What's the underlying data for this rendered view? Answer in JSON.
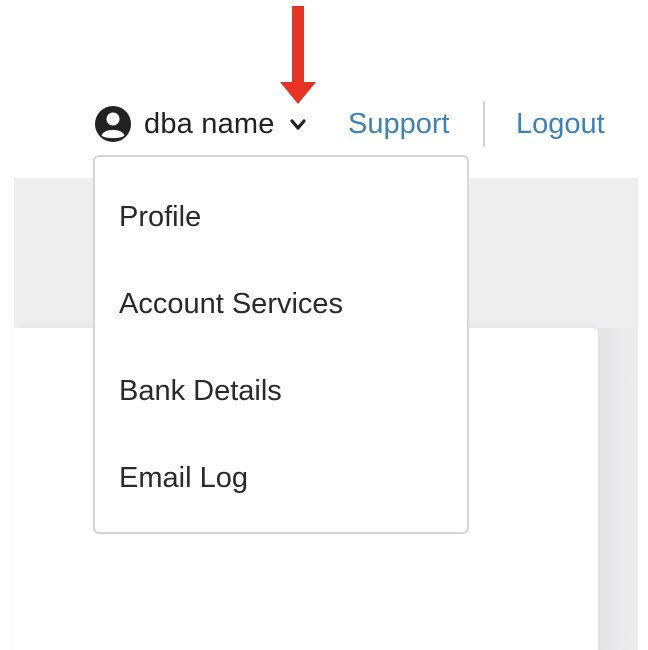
{
  "header": {
    "user": {
      "name": "dba name",
      "avatar_icon": "user-circle-icon",
      "toggle_icon": "chevron-down-icon"
    },
    "links": {
      "support": "Support",
      "logout": "Logout"
    },
    "link_color": "#3f82b8"
  },
  "user_dropdown": {
    "items": [
      {
        "label": "Profile"
      },
      {
        "label": "Account Services"
      },
      {
        "label": "Bank Details"
      },
      {
        "label": "Email Log"
      }
    ]
  },
  "annotation": {
    "icon": "arrow-down-icon",
    "color": "#e63323"
  }
}
